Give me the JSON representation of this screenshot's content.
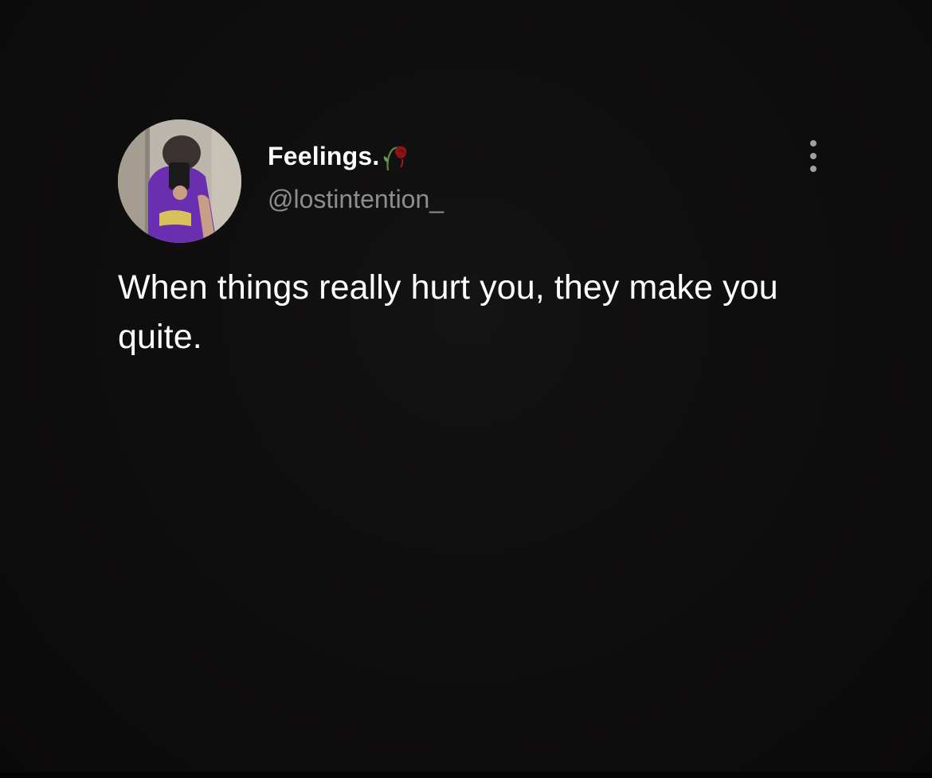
{
  "tweet": {
    "author": {
      "display_name": "Feelings.",
      "name_emoji": "wilted-rose-icon",
      "handle": "@lostintention_",
      "avatar": "avatar"
    },
    "more_icon": "more-options-icon",
    "text": "When things really hurt you, they make you quite."
  },
  "colors": {
    "background": "#0e0d0d",
    "text_primary": "#ffffff",
    "text_secondary": "#8b8e91",
    "hoodie": "#6a2fb0"
  }
}
